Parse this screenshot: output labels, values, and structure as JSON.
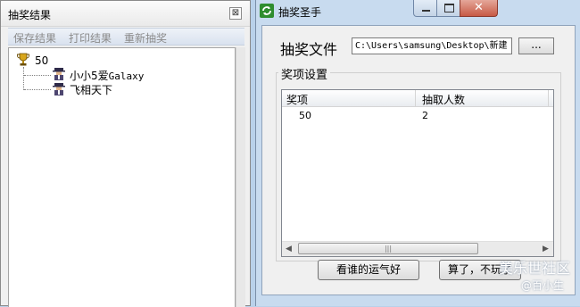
{
  "left_window": {
    "title": "抽奖结果",
    "close_symbol": "⊠",
    "toolbar": {
      "save": "保存结果",
      "print": "打印结果",
      "redraw": "重新抽奖"
    },
    "tree": {
      "root_label": "50",
      "root_icon": "trophy-icon",
      "children": [
        {
          "prefix": "小小5爱",
          "suffix": "Galaxy",
          "icon": "person-icon"
        },
        {
          "prefix": "飞相天下",
          "suffix": "",
          "icon": "person-icon"
        }
      ]
    }
  },
  "right_window": {
    "title": "抽奖圣手",
    "icon": "app-refresh-icon",
    "close_symbol": "✕",
    "file_label": "抽奖文件",
    "file_value": "C:\\Users\\samsung\\Desktop\\新建",
    "browse_label": "...",
    "group_title": "奖项设置",
    "columns": [
      "奖项",
      "抽取人数"
    ],
    "rows": [
      {
        "prize": "50",
        "count": "2"
      }
    ],
    "scroll_left": "◀",
    "scroll_right": "▶",
    "scroll_grip": "|||",
    "buttons": {
      "who_lucky": "看谁的运气好",
      "quit": "算了，不玩了"
    }
  },
  "watermark": {
    "line1": "美乐世社区",
    "line2": "@百小生"
  },
  "colors": {
    "desktop": "#b9d1ea",
    "right_frame": "#c8dbef",
    "close_button": "#c75a45"
  }
}
